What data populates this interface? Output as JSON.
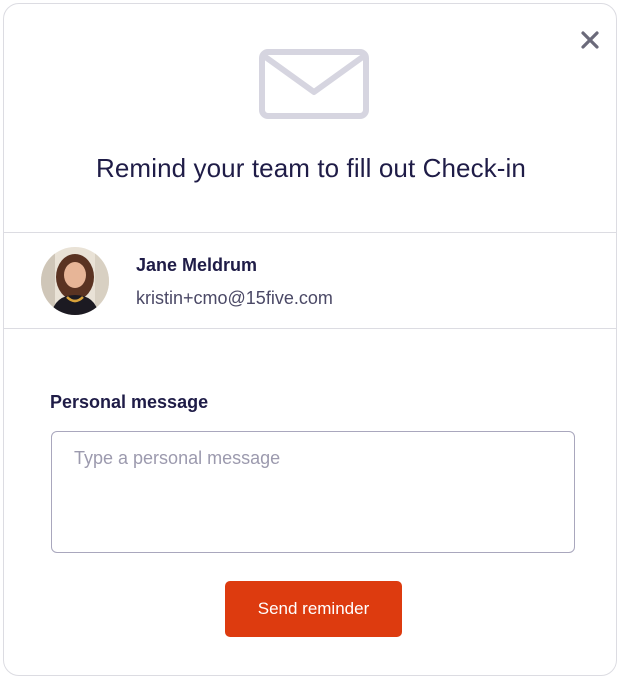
{
  "modal": {
    "title": "Remind your team to fill out Check-in",
    "close_icon": "close-icon",
    "header_icon": "envelope-icon"
  },
  "recipient": {
    "name": "Jane Meldrum",
    "email": "kristin+cmo@15five.com"
  },
  "form": {
    "label": "Personal message",
    "placeholder": "Type a personal message",
    "value": ""
  },
  "actions": {
    "send_label": "Send reminder"
  },
  "colors": {
    "primary_button": "#dd3b0f",
    "heading_text": "#1f1c47",
    "divider": "#dcdce2",
    "icon_muted": "#d6d5e0"
  }
}
